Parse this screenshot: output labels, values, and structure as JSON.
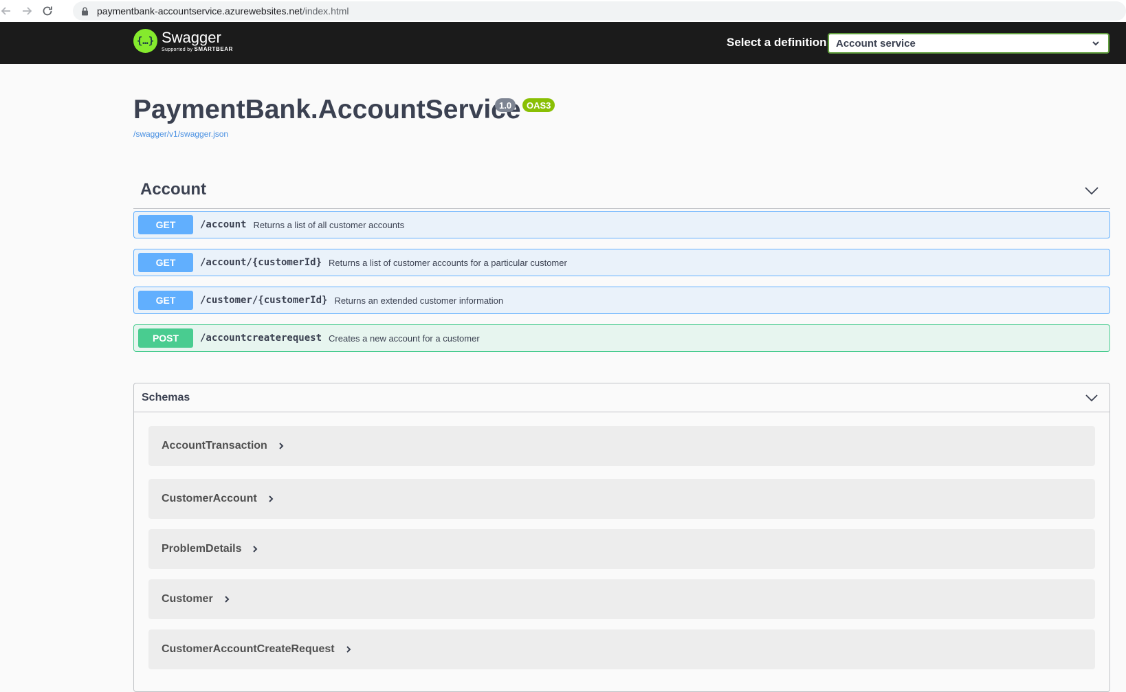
{
  "browser": {
    "url_host": "paymentbank-accountservice.azurewebsites.net",
    "url_path": "/index.html"
  },
  "topbar": {
    "logo_title": "Swagger",
    "logo_sub_prefix": "Supported by",
    "logo_sub_brand": "SMARTBEAR",
    "definition_label": "Select a definition",
    "definition_selected": "Account service"
  },
  "info": {
    "title": "PaymentBank.AccountService",
    "version": "1.0",
    "oas": "OAS3",
    "spec_url": "/swagger/v1/swagger.json"
  },
  "tag": {
    "name": "Account",
    "operations": [
      {
        "method": "GET",
        "path": "/account",
        "summary": "Returns a list of all customer accounts"
      },
      {
        "method": "GET",
        "path": "/account/{customerId}",
        "summary": "Returns a list of customer accounts for a particular customer"
      },
      {
        "method": "GET",
        "path": "/customer/{customerId}",
        "summary": "Returns an extended customer information"
      },
      {
        "method": "POST",
        "path": "/accountcreaterequest",
        "summary": "Creates a new account for a customer"
      }
    ]
  },
  "schemas": {
    "title": "Schemas",
    "items": [
      "AccountTransaction",
      "CustomerAccount",
      "ProblemDetails",
      "Customer",
      "CustomerAccountCreateRequest"
    ]
  },
  "colors": {
    "get": "#61affe",
    "post": "#49cc90",
    "topbar": "#1b1b1b",
    "select_border": "#62a03f",
    "logo": "#85ea2d"
  },
  "icons": {
    "back": "arrow-left-icon",
    "forward": "arrow-right-icon",
    "reload": "reload-icon",
    "lock": "lock-icon",
    "expand": "chevron-down-icon",
    "model_expand": "chevron-right-icon"
  }
}
